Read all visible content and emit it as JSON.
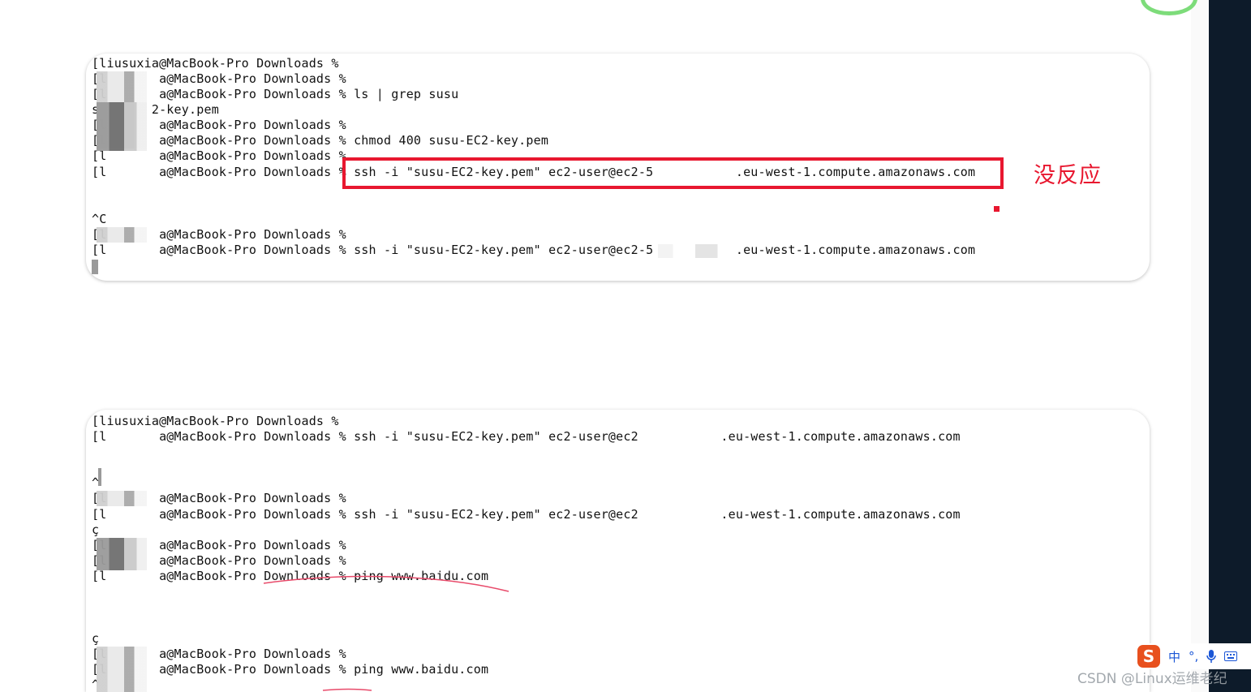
{
  "panel1": {
    "lines": [
      "[liusuxia@MacBook-Pro Downloads %",
      "[l       a@MacBook-Pro Downloads %",
      "[l       a@MacBook-Pro Downloads % ls | grep susu",
      "s       2-key.pem",
      "[l       a@MacBook-Pro Downloads %",
      "[l       a@MacBook-Pro Downloads % chmod 400 susu-EC2-key.pem",
      "[l       a@MacBook-Pro Downloads %",
      "[l       a@MacBook-Pro Downloads % ssh -i \"susu-EC2-key.pem\" ec2-user@ec2-5           .eu-west-1.compute.amazonaws.com",
      "",
      "",
      "^C",
      "[l       a@MacBook-Pro Downloads %",
      "[l       a@MacBook-Pro Downloads % ssh -i \"susu-EC2-key.pem\" ec2-user@ec2-5           .eu-west-1.compute.amazonaws.com"
    ],
    "annotation": "没反应"
  },
  "panel2": {
    "lines": [
      "[liusuxia@MacBook-Pro Downloads %",
      "[l       a@MacBook-Pro Downloads % ssh -i \"susu-EC2-key.pem\" ec2-user@ec2           .eu-west-1.compute.amazonaws.com",
      "",
      "",
      "^",
      "[l       a@MacBook-Pro Downloads %",
      "[l       a@MacBook-Pro Downloads % ssh -i \"susu-EC2-key.pem\" ec2-user@ec2           .eu-west-1.compute.amazonaws.com",
      "ç",
      "[l       a@MacBook-Pro Downloads %",
      "[l       a@MacBook-Pro Downloads %",
      "[l       a@MacBook-Pro Downloads % ping www.baidu.com",
      "",
      "",
      "",
      "ç",
      "[l       a@MacBook-Pro Downloads %",
      "[l       a@MacBook-Pro Downloads % ping www.baidu.com",
      "^"
    ]
  },
  "ime": {
    "logo": "S",
    "mode": "中",
    "punct": "°,",
    "mic_icon": "mic-icon",
    "keyboard_icon": "keyboard-icon"
  },
  "watermark": "CSDN @Linux运维老纪",
  "colors": {
    "annotation": "#e8172f",
    "sidebar": "#0d1b2a",
    "ime_accent": "#e8501e"
  }
}
